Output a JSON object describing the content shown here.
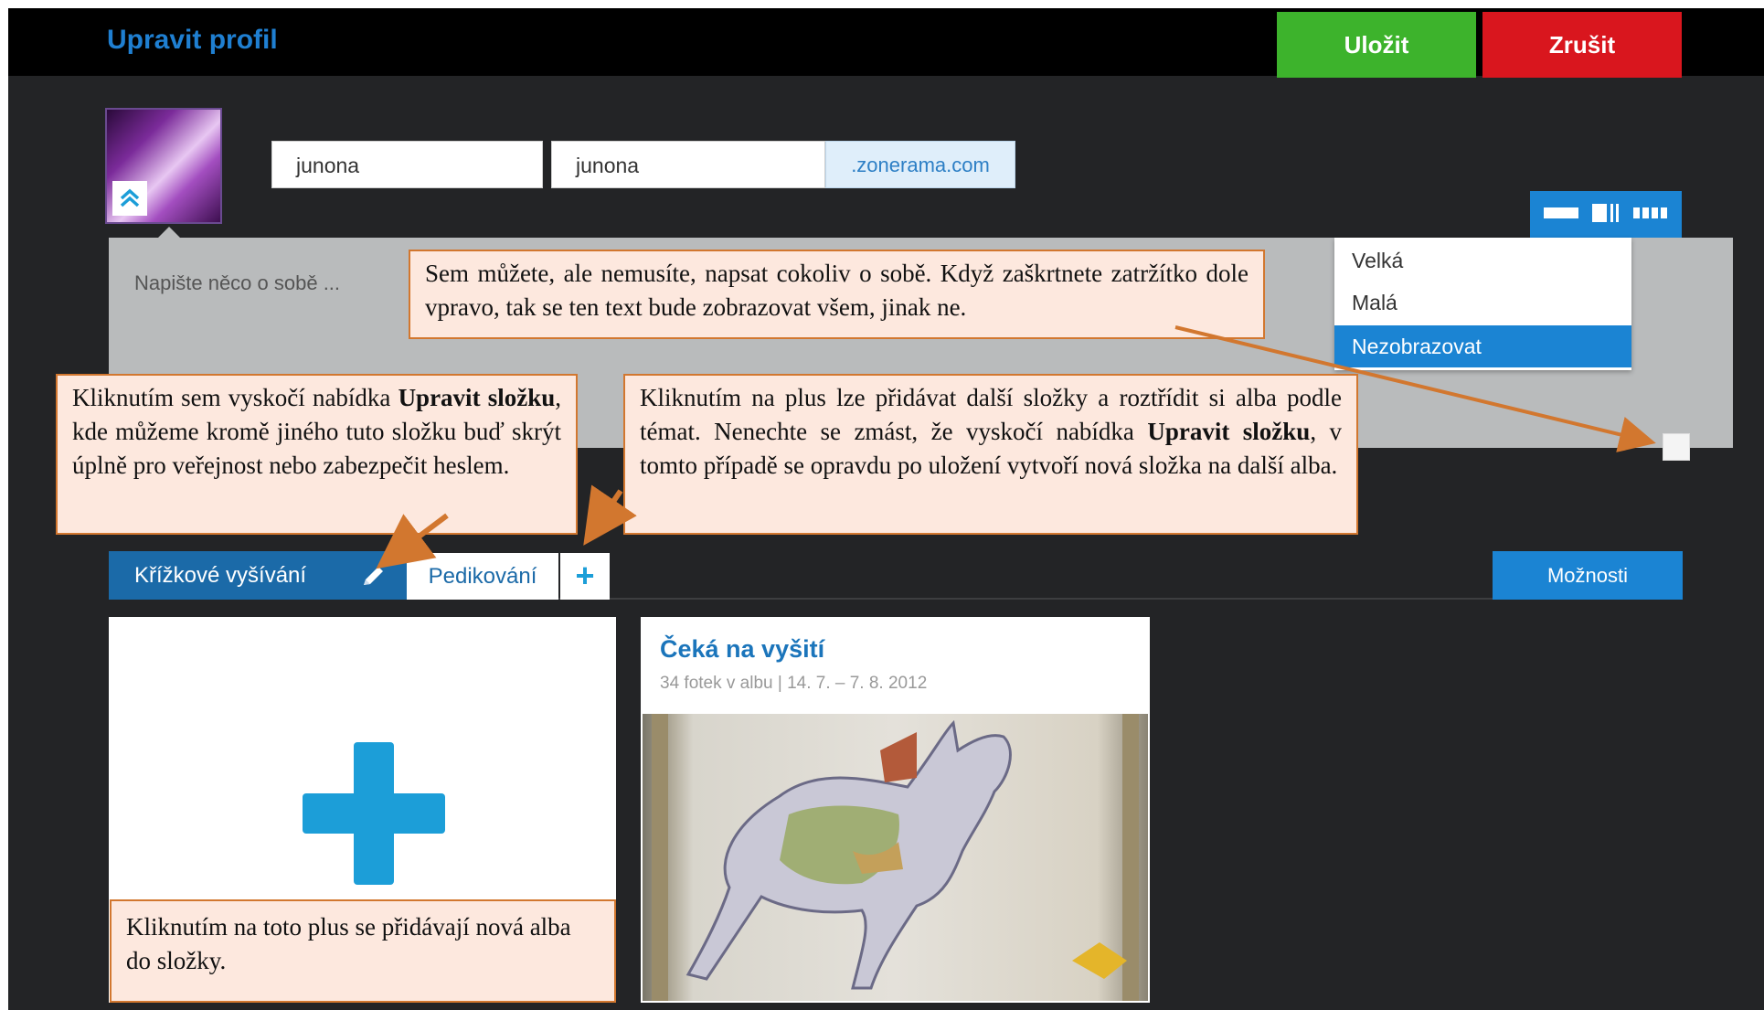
{
  "header": {
    "title": "Upravit profil",
    "save_label": "Uložit",
    "cancel_label": "Zrušit"
  },
  "profile": {
    "name_value": "junona",
    "subdomain_value": "junona",
    "domain_suffix": ".zonerama.com",
    "about_placeholder": "Napište něco o sobě ..."
  },
  "display_menu": {
    "items": [
      "Velká",
      "Malá",
      "Nezobrazovat"
    ],
    "selected": "Nezobrazovat"
  },
  "tabs": {
    "active_label": "Křížkové vyšívání",
    "second_label": "Pedikování",
    "add_label": "+",
    "options_label": "Možnosti"
  },
  "album": {
    "title": "Čeká na vyšití",
    "meta": "34 fotek v albu | 14. 7. – 7. 8. 2012"
  },
  "notes": {
    "about_note": "Sem můžete, ale nemusíte, napsat cokoliv o sobě. Když zaškrtnete zatržítko dole vpravo, tak se ten text bude zobrazovat všem, jinak ne.",
    "edit_note_a": "Kliknutím sem vyskočí nabídka ",
    "edit_note_b": "Upravit složku",
    "edit_note_c": ", kde můžeme kromě jiného tuto složku buď skrýt úplně pro veřejnost nebo zabezpečit heslem.",
    "plus_note_a": "Kliknutím na plus lze přidávat další složky a roztřídit si alba podle témat. Nenechte se zmást, že vyskočí nabídka ",
    "plus_note_b": "Upravit složku",
    "plus_note_c": ", v tomto případě se opravdu po uložení vytvoří nová složka na další alba.",
    "add_album_note": "Kliknutím na toto plus se přidávají nová alba do složky."
  },
  "colors": {
    "accent_blue": "#1b84d3",
    "save_green": "#3db32c",
    "cancel_red": "#d9161e",
    "note_border": "#d2772f",
    "note_fill": "#fde8de"
  },
  "icons": [
    "chevron-up-icon",
    "pencil-icon",
    "plus-icon",
    "view-wide-icon",
    "view-split-icon",
    "view-grid-icon"
  ]
}
